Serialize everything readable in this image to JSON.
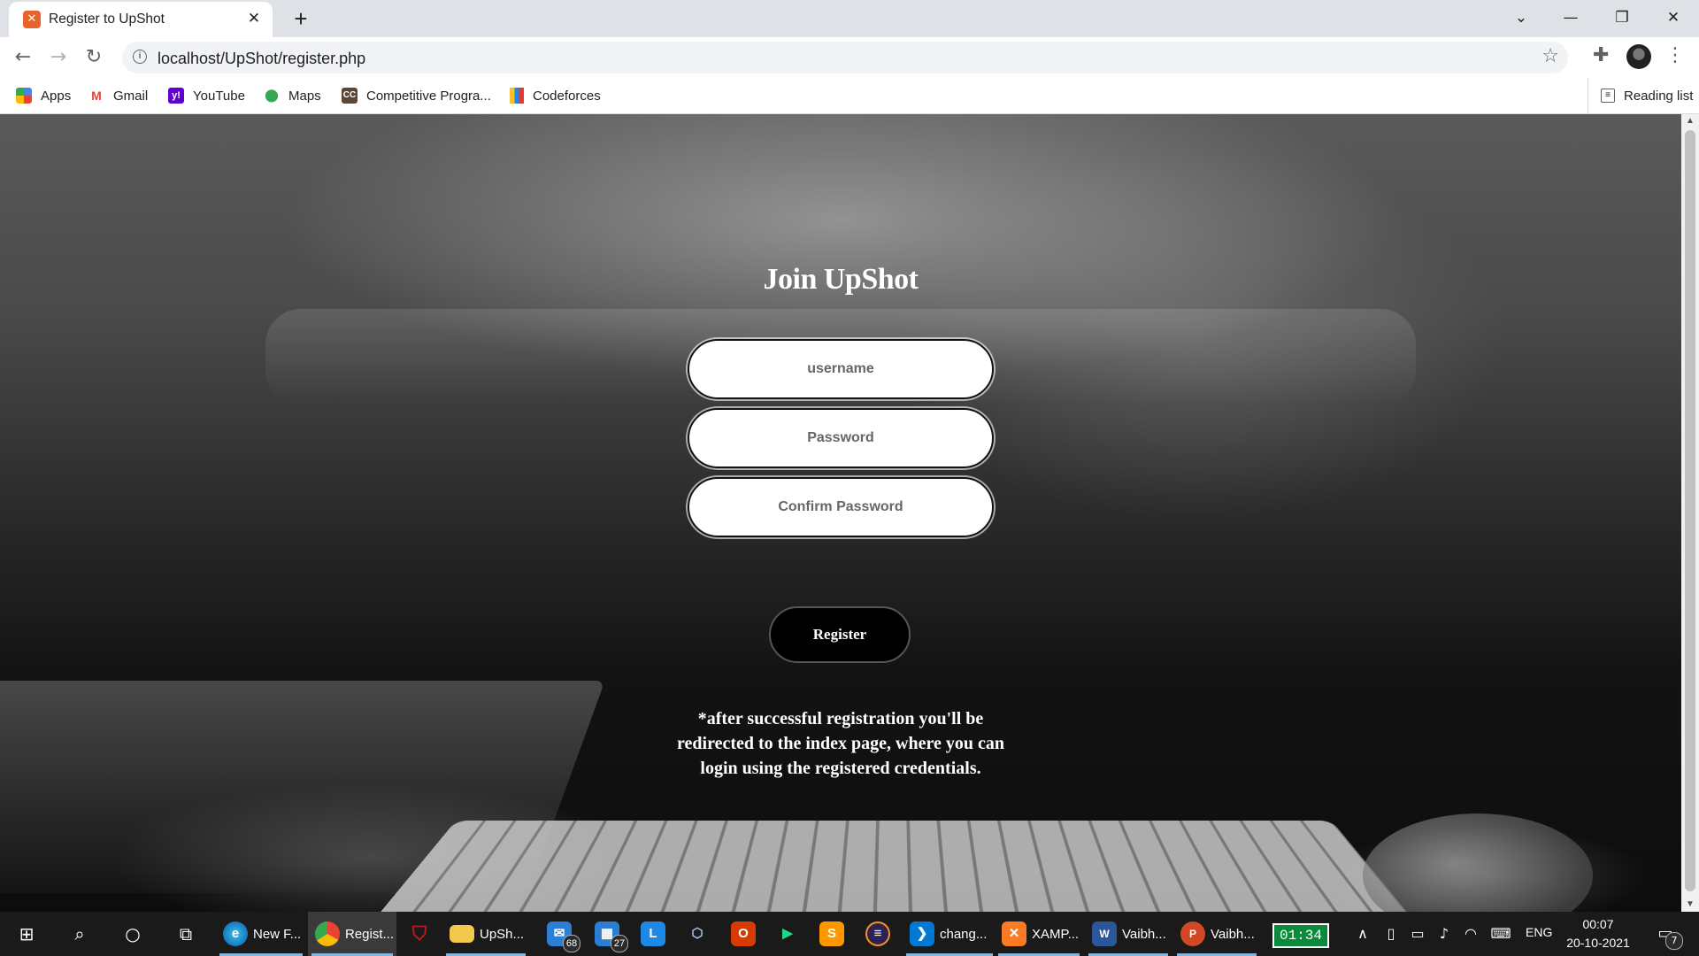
{
  "browser": {
    "tab_title": "Register to UpShot",
    "tab_favicon": "xampp-icon",
    "close_glyph": "✕",
    "new_tab_glyph": "+",
    "url": "localhost/UpShot/register.php",
    "bookmarks": [
      {
        "label": "Apps",
        "icon": "apps-grid-icon"
      },
      {
        "label": "Gmail",
        "icon": "gmail-icon"
      },
      {
        "label": "YouTube",
        "icon": "yahoo-icon"
      },
      {
        "label": "Maps",
        "icon": "maps-pin-icon"
      },
      {
        "label": "Competitive Progra...",
        "icon": "codechef-icon"
      },
      {
        "label": "Codeforces",
        "icon": "codeforces-icon"
      }
    ],
    "reading_list": "Reading list"
  },
  "page": {
    "title": "Join UpShot",
    "username_placeholder": "username",
    "password_placeholder": "Password",
    "confirm_placeholder": "Confirm Password",
    "register_label": "Register",
    "note": "*after successful registration you'll be redirected to the index page, where you can login using the registered credentials."
  },
  "taskbar": {
    "apps": [
      {
        "label": "New F...",
        "icon": "edge-icon"
      },
      {
        "label": "Regist...",
        "icon": "chrome-icon",
        "active": true
      },
      {
        "label": "",
        "icon": "mcafee-icon"
      },
      {
        "label": "UpSh...",
        "icon": "folder-icon"
      },
      {
        "label": "",
        "icon": "mail-icon",
        "badge": "68"
      },
      {
        "label": "",
        "icon": "calendar-icon",
        "badge": "27"
      },
      {
        "label": "",
        "icon": "l-app-icon"
      },
      {
        "label": "",
        "icon": "virtualbox-icon"
      },
      {
        "label": "",
        "icon": "office-icon"
      },
      {
        "label": "",
        "icon": "pycharm-icon"
      },
      {
        "label": "",
        "icon": "sublime-icon"
      },
      {
        "label": "",
        "icon": "eclipse-icon"
      },
      {
        "label": "chang...",
        "icon": "vscode-icon"
      },
      {
        "label": "XAMP...",
        "icon": "xampp-icon"
      },
      {
        "label": "Vaibh...",
        "icon": "word-icon"
      },
      {
        "label": "Vaibh...",
        "icon": "powerpoint-icon"
      }
    ],
    "timer": "01:34",
    "language": "ENG",
    "time": "00:07",
    "date": "20-10-2021",
    "notification_count": "7"
  },
  "colors": {
    "tab_strip": "#dee1e6",
    "accent_underline": "#76b9ed",
    "timer_green": "#0b8a3e"
  }
}
